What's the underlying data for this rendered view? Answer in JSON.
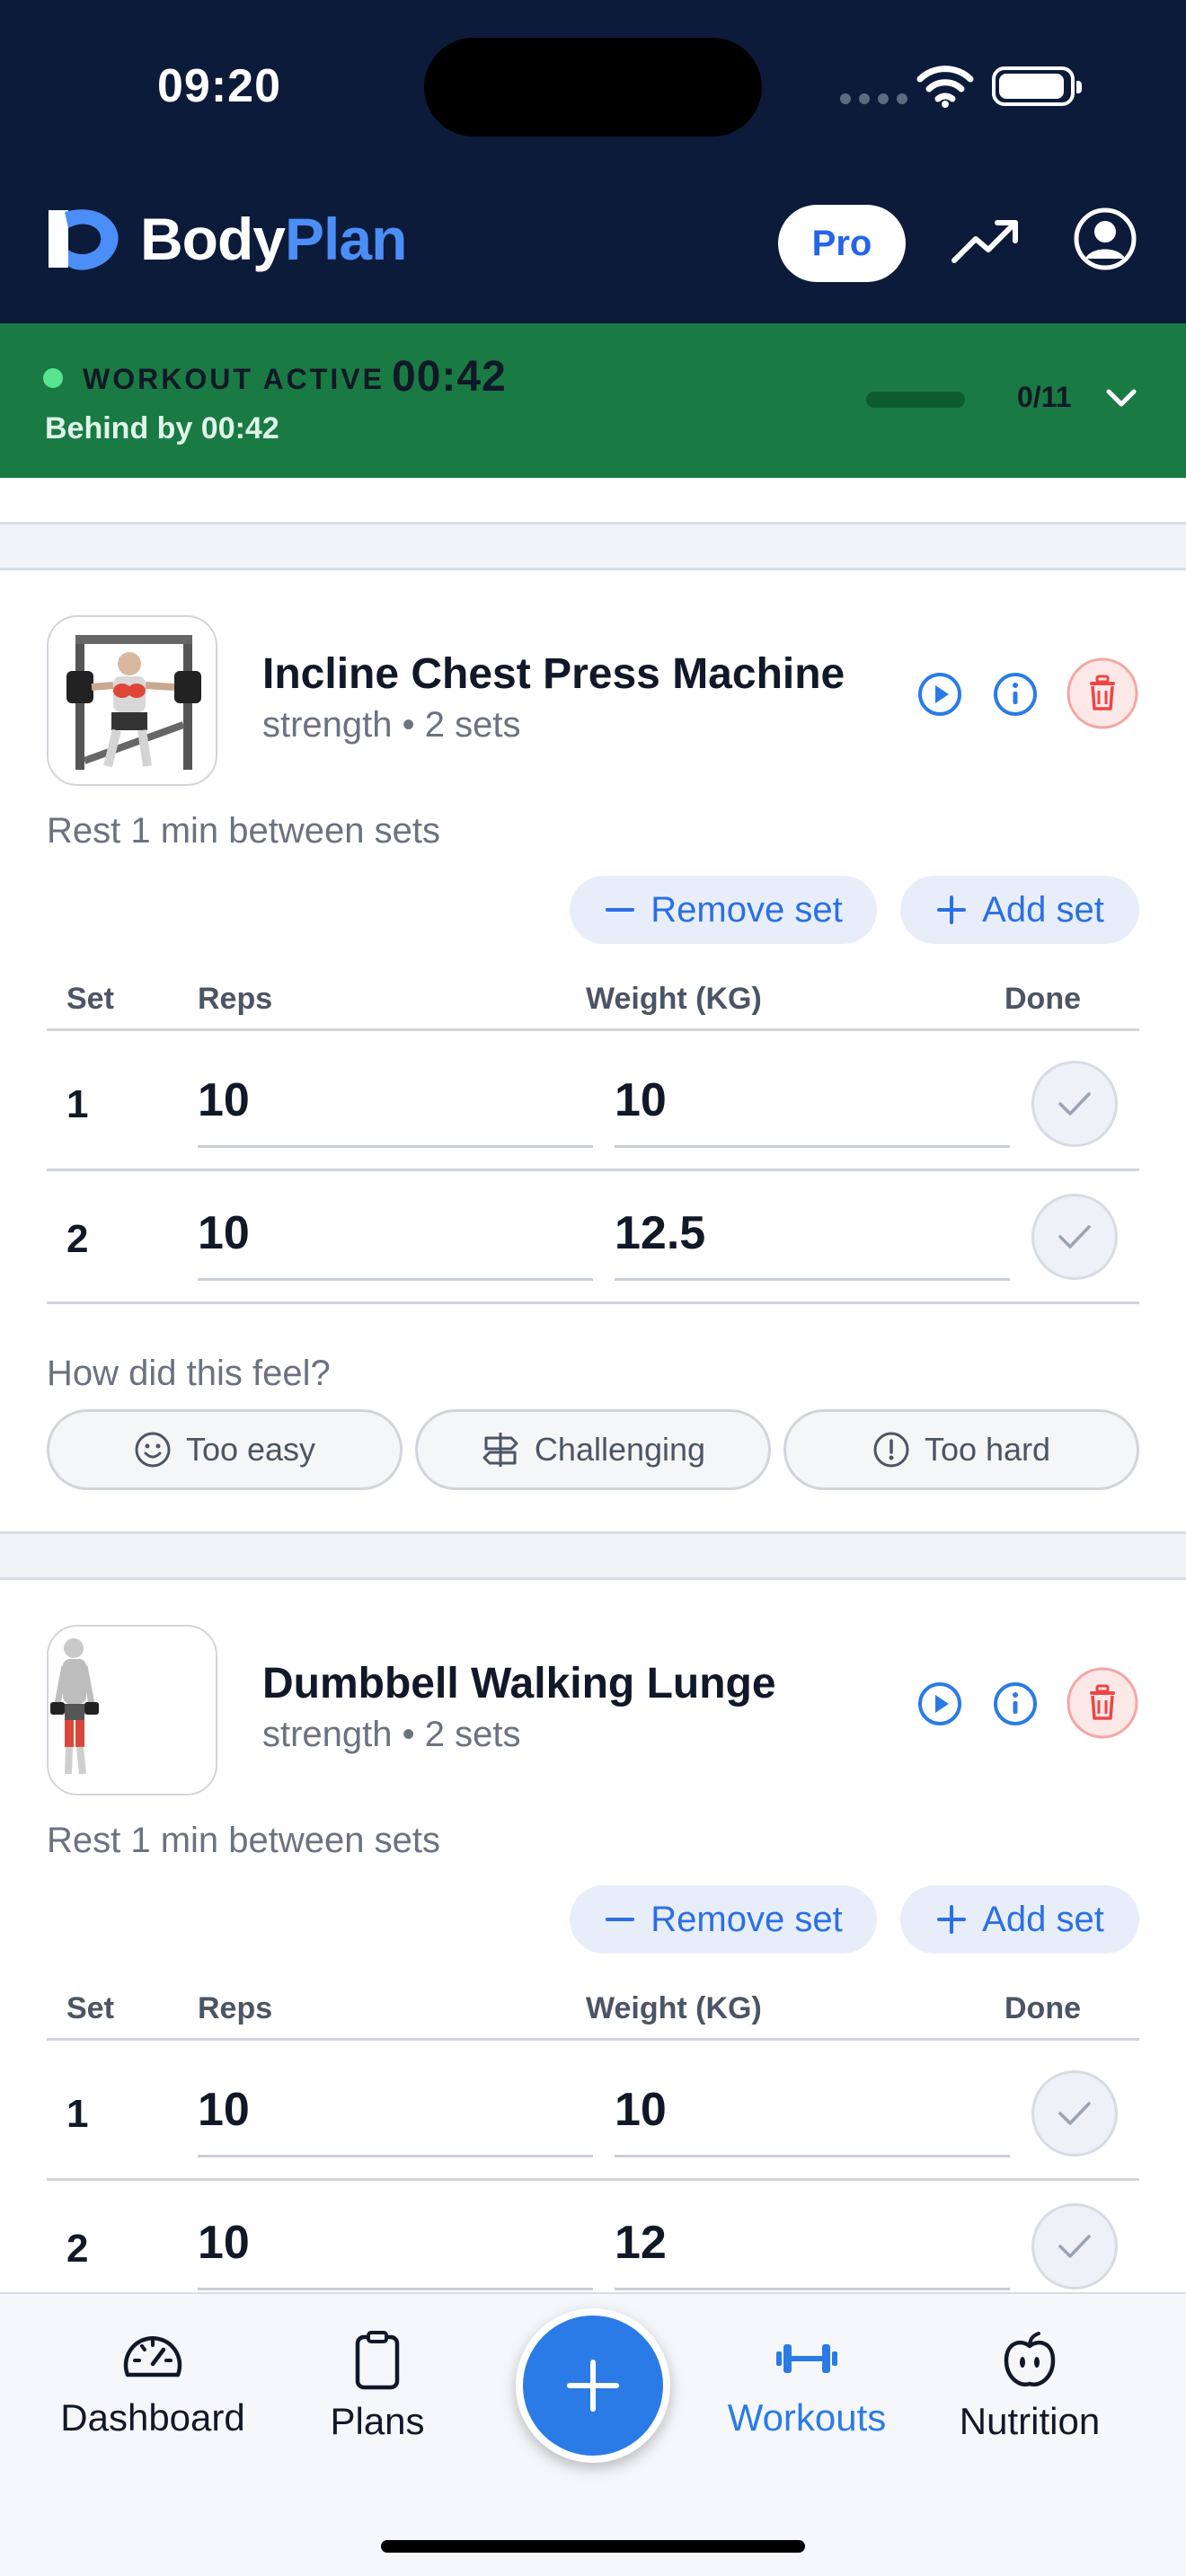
{
  "status_bar": {
    "time": "09:20"
  },
  "header": {
    "brand_part1": "Body",
    "brand_part2": "Plan",
    "pro_label": "Pro"
  },
  "active_workout": {
    "label": "WORKOUT ACTIVE",
    "timer": "00:42",
    "behind_text": "Behind by 00:42",
    "progress": "0/11",
    "progress_fraction": 0.0
  },
  "exercises": [
    {
      "name": "Incline Chest Press Machine",
      "meta": "strength • 2 sets",
      "rest": "Rest 1 min between sets",
      "remove_label": "Remove set",
      "add_label": "Add set",
      "headers": {
        "set": "Set",
        "reps": "Reps",
        "weight": "Weight (KG)",
        "done": "Done"
      },
      "sets": [
        {
          "set": "1",
          "reps": "10",
          "weight": "10"
        },
        {
          "set": "2",
          "reps": "10",
          "weight": "12.5"
        }
      ],
      "feel_question": "How did this feel?",
      "feel_options": [
        "Too easy",
        "Challenging",
        "Too hard"
      ]
    },
    {
      "name": "Dumbbell Walking Lunge",
      "meta": "strength • 2 sets",
      "rest": "Rest 1 min between sets",
      "remove_label": "Remove set",
      "add_label": "Add set",
      "headers": {
        "set": "Set",
        "reps": "Reps",
        "weight": "Weight (KG)",
        "done": "Done"
      },
      "sets": [
        {
          "set": "1",
          "reps": "10",
          "weight": "10"
        },
        {
          "set": "2",
          "reps": "10",
          "weight": "12"
        }
      ]
    }
  ],
  "nav": {
    "dashboard": "Dashboard",
    "plans": "Plans",
    "workouts": "Workouts",
    "nutrition": "Nutrition",
    "active_item": "Workouts"
  },
  "colors": {
    "header_bg": "#0d1b3a",
    "active_bar_bg": "#1a7a44",
    "accent": "#2b7be6",
    "danger": "#ef4444"
  }
}
